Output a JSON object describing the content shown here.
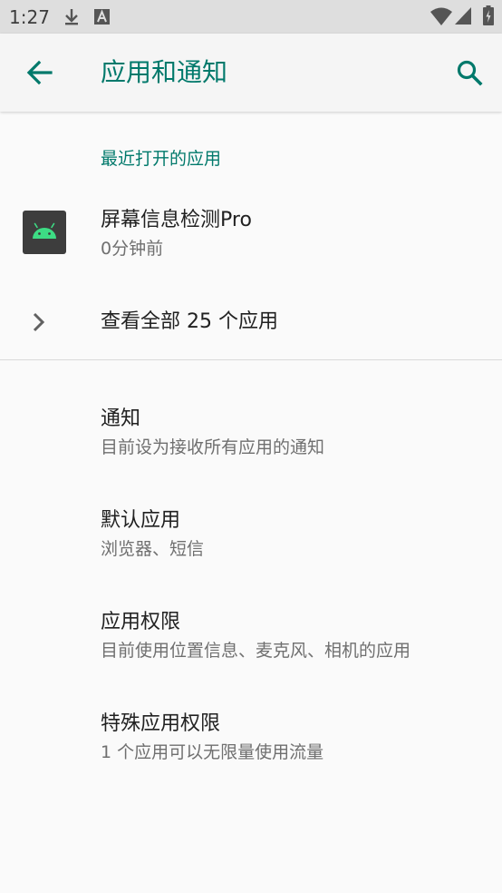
{
  "status_bar": {
    "time": "1:27",
    "icons": [
      "download-icon",
      "a-box-icon",
      "wifi-icon",
      "signal-icon",
      "battery-icon"
    ]
  },
  "app_bar": {
    "title": "应用和通知",
    "back_icon": "arrow-back-icon",
    "search_icon": "search-icon"
  },
  "recent_apps": {
    "header": "最近打开的应用",
    "items": [
      {
        "name": "屏幕信息检测Pro",
        "subtitle": "0分钟前",
        "icon": "android-icon"
      }
    ],
    "see_all_label": "查看全部 25 个应用"
  },
  "settings": [
    {
      "title": "通知",
      "subtitle": "目前设为接收所有应用的通知"
    },
    {
      "title": "默认应用",
      "subtitle": "浏览器、短信"
    },
    {
      "title": "应用权限",
      "subtitle": "目前使用位置信息、麦克风、相机的应用"
    },
    {
      "title": "特殊应用权限",
      "subtitle": "1 个应用可以无限量使用流量"
    }
  ],
  "colors": {
    "accent": "#00796b",
    "status_bar_bg": "#dedede",
    "app_bar_bg": "#f5f5f5",
    "page_bg": "#fafafa",
    "android_green": "#3ddc84"
  }
}
